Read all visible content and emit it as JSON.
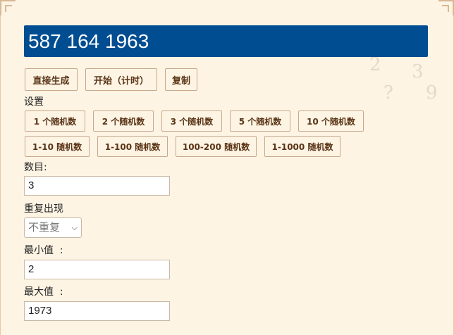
{
  "result": "587 164 1963",
  "actions": {
    "generate": "直接生成",
    "start": "开始（计时）",
    "copy": "复制"
  },
  "settings_label": "设置",
  "presets": [
    "1 个随机数",
    "2 个随机数",
    "3 个随机数",
    "5 个随机数",
    "10 个随机数",
    "1-10 随机数",
    "1-100 随机数",
    "100-200 随机数",
    "1-1000 随机数"
  ],
  "count": {
    "label": "数目:",
    "value": "3"
  },
  "repeat": {
    "label": "重复出现",
    "selected": "不重复"
  },
  "min": {
    "label": "最小值  :",
    "value": "2"
  },
  "max": {
    "label": "最大值  :",
    "value": "1973"
  },
  "colors": {
    "result_bg": "#004d91",
    "page_bg": "#fdf4e4",
    "button_text": "#5a3416"
  }
}
